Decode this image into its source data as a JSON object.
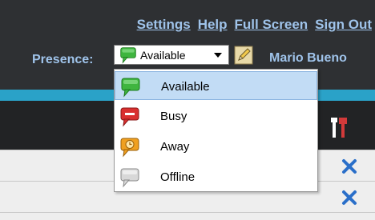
{
  "header": {
    "links": [
      "Settings",
      "Help",
      "Full Screen",
      "Sign Out"
    ],
    "presence_label": "Presence:",
    "presence_value": "Available",
    "user_name": "Mario Bueno"
  },
  "dropdown": {
    "options": [
      "Available",
      "Busy",
      "Away",
      "Offline"
    ],
    "selected": "Available"
  },
  "icons": {
    "available": "green-speech-bubble-icon",
    "busy": "red-speech-bubble-icon",
    "away": "orange-clock-bubble-icon",
    "offline": "gray-speech-bubble-icon",
    "edit": "pencil-icon",
    "tools": "tools-icon",
    "remove": "close-x-icon"
  },
  "colors": {
    "header_bg": "#2e3033",
    "link": "#9fc3ea",
    "teal": "#2aa2c8",
    "selected_bg": "#c2dcf5",
    "remove_x": "#2a6fc9"
  }
}
